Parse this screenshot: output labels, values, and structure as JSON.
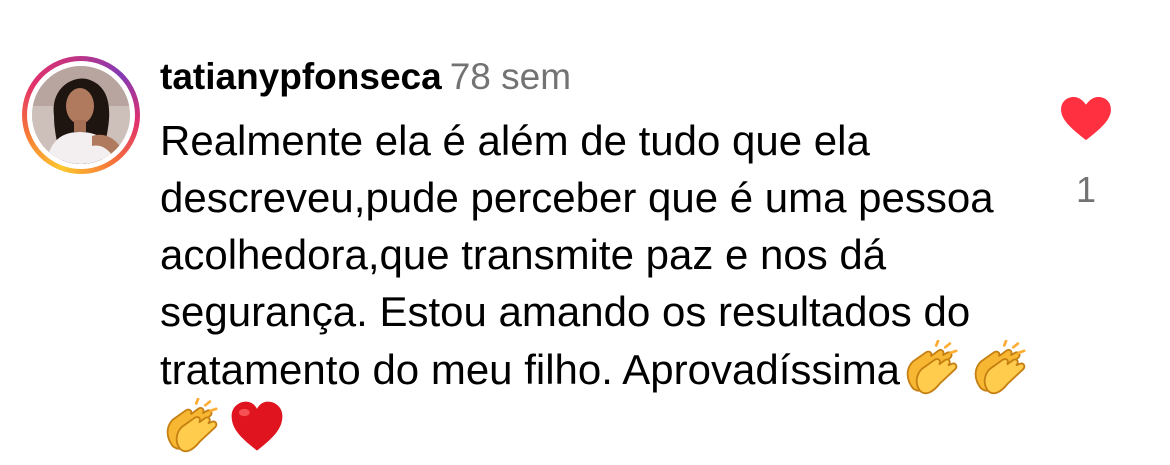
{
  "comment": {
    "username": "tatianypfonseca",
    "time": "78 sem",
    "text": "Realmente ela é além de tudo que ela descreveu,pude perceber que é uma pessoa acolhedora,que transmite paz e nos dá segurança. Estou amando os resultados do tratamento do meu filho. Aprovadíssima",
    "emojis": [
      "clapping-hands",
      "clapping-hands",
      "clapping-hands",
      "red-heart"
    ],
    "likes": "1"
  },
  "colors": {
    "like": "#ff3040",
    "secondary_text": "#737373",
    "text": "#000000"
  }
}
